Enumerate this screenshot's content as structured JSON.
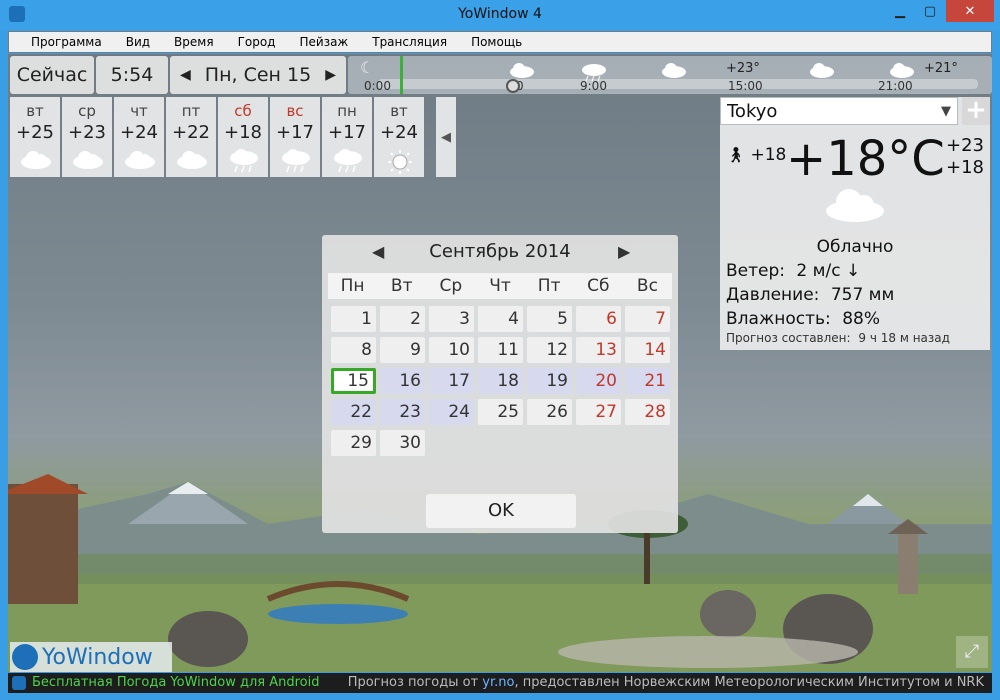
{
  "window": {
    "title": "YoWindow 4"
  },
  "menu": [
    "Программа",
    "Вид",
    "Время",
    "Город",
    "Пейзаж",
    "Трансляция",
    "Помощь"
  ],
  "now": {
    "label": "Сейчас",
    "time": "5:54",
    "date": "Пн, Сен 15"
  },
  "timeline": {
    "labels": [
      "0:00",
      "9:00",
      "15:00",
      "21:00"
    ],
    "temps": [
      "+23°",
      "+21°"
    ],
    "partial_label": "0"
  },
  "days": [
    {
      "name": "вт",
      "temp": "+25",
      "icon": "cloud-icon",
      "weekend": false
    },
    {
      "name": "ср",
      "temp": "+23",
      "icon": "cloud-icon",
      "weekend": false
    },
    {
      "name": "чт",
      "temp": "+24",
      "icon": "cloud-icon",
      "weekend": false
    },
    {
      "name": "пт",
      "temp": "+22",
      "icon": "cloud-icon",
      "weekend": false
    },
    {
      "name": "сб",
      "temp": "+18",
      "icon": "rain-cloud-icon",
      "weekend": true
    },
    {
      "name": "вс",
      "temp": "+17",
      "icon": "rain-cloud-icon",
      "weekend": true
    },
    {
      "name": "пн",
      "temp": "+17",
      "icon": "rain-cloud-icon",
      "weekend": false
    },
    {
      "name": "вт",
      "temp": "+24",
      "icon": "sun-icon",
      "weekend": false
    }
  ],
  "city": {
    "name": "Tokyo",
    "feels": "+18",
    "temp": "+18°C",
    "high": "+23",
    "low": "+18",
    "condition": "Облачно",
    "wind_label": "Ветер:",
    "wind_value": "2 м/с ↓",
    "pressure_label": "Давление:",
    "pressure_value": "757 мм",
    "humidity_label": "Влажность:",
    "humidity_value": "88%",
    "forecast_label": "Прогноз составлен:",
    "forecast_value": "9 ч 18 м назад"
  },
  "calendar": {
    "month": "Сентябрь 2014",
    "weekdays": [
      "Пн",
      "Вт",
      "Ср",
      "Чт",
      "Пт",
      "Сб",
      "Вс"
    ],
    "ok": "OK",
    "rows": [
      [
        "1",
        "2",
        "3",
        "4",
        "5",
        "6",
        "7"
      ],
      [
        "8",
        "9",
        "10",
        "11",
        "12",
        "13",
        "14"
      ],
      [
        "15",
        "16",
        "17",
        "18",
        "19",
        "20",
        "21"
      ],
      [
        "22",
        "23",
        "24",
        "25",
        "26",
        "27",
        "28"
      ],
      [
        "29",
        "30"
      ]
    ]
  },
  "brand": "YoWindow",
  "status": {
    "promo": "Бесплатная Погода YoWindow для Android",
    "credit_pre": "Прогноз погоды от ",
    "credit_link": "yr.no",
    "credit_post": ", предоставлен Норвежским Метеорологическим Институтом и NRK"
  },
  "colors": {
    "accent": "#3aa0e8",
    "selected": "#38a828",
    "weekend": "#c0392b",
    "highlight": "#d7d9ee"
  }
}
